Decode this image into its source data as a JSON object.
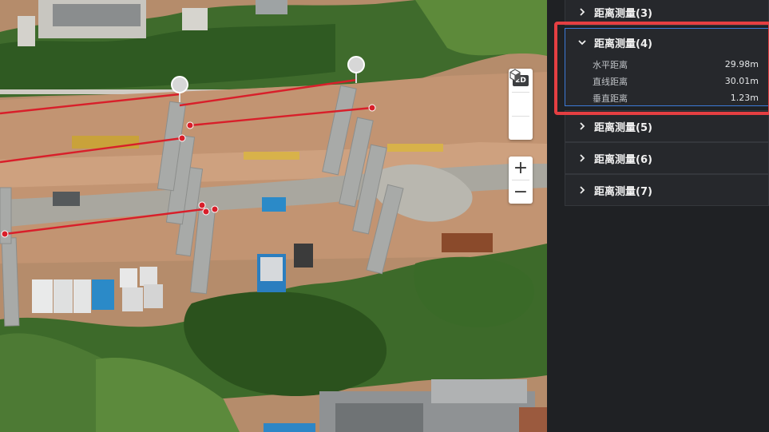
{
  "map": {
    "toolbar": {
      "mode_2d_label": "2D",
      "zoom_in_symbol": "+",
      "zoom_out_symbol": "−"
    }
  },
  "panel": {
    "items": [
      {
        "title": "距离测量(3)",
        "expanded": false
      },
      {
        "title": "距离测量(4)",
        "expanded": true,
        "rows": [
          {
            "label": "水平距离",
            "value": "29.98m"
          },
          {
            "label": "直线距离",
            "value": "30.01m"
          },
          {
            "label": "垂直距离",
            "value": "1.23m"
          }
        ]
      },
      {
        "title": "距离测量(5)",
        "expanded": false
      },
      {
        "title": "距离测量(6)",
        "expanded": false
      },
      {
        "title": "距离测量(7)",
        "expanded": false
      }
    ]
  },
  "colors": {
    "measure_line": "#d81f2a",
    "highlight_border": "#e53f42",
    "active_border": "#3c7ad8",
    "panel_bg": "#1f2124"
  }
}
